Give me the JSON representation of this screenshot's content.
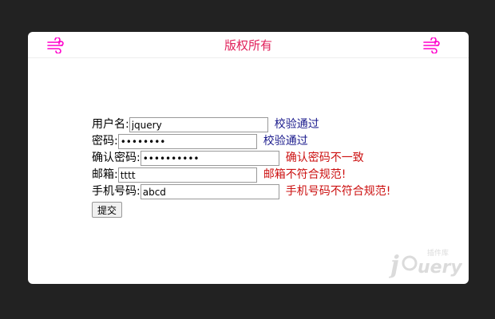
{
  "header": {
    "title": "版权所有",
    "left_icon": "wind-icon",
    "right_icon": "wind-icon",
    "accent_color": "#e0205a",
    "icon_color": "#ff00cc"
  },
  "form": {
    "username": {
      "label": "用户名:",
      "value": "jquery",
      "message": "校验通过",
      "status": "ok"
    },
    "password": {
      "label": "密码:",
      "value": "••••••••",
      "message": "校验通过",
      "status": "ok"
    },
    "confirm_password": {
      "label": "确认密码:",
      "value": "••••••••••",
      "message": "确认密码不一致",
      "status": "error"
    },
    "email": {
      "label": "邮箱:",
      "value": "tttt",
      "message": "邮箱不符合规范!",
      "status": "error"
    },
    "phone": {
      "label": "手机号码:",
      "value": "abcd",
      "message": "手机号码不符合规范!",
      "status": "error"
    },
    "submit_label": "提交"
  },
  "watermark": {
    "brand": "jQuery",
    "sub": "插件库"
  }
}
